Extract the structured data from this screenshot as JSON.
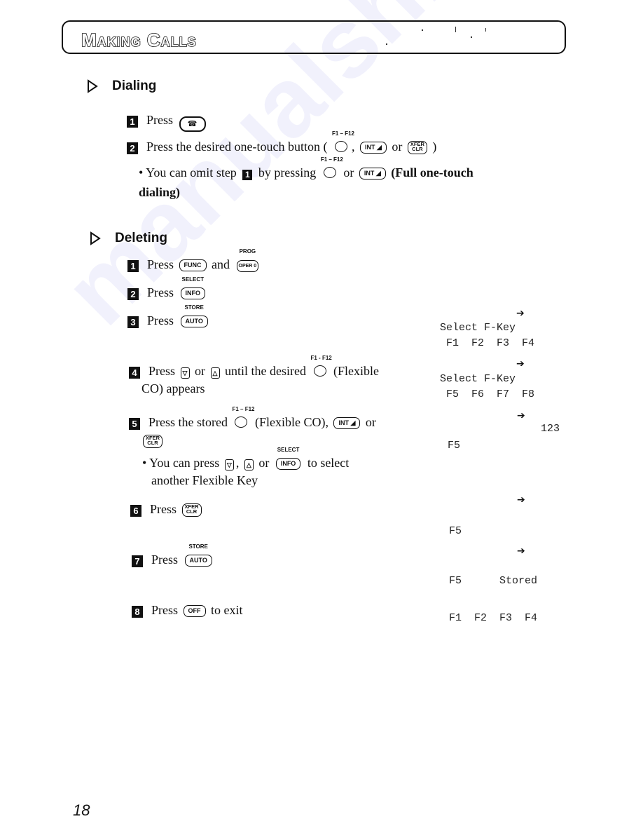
{
  "header": {
    "title": "Making Calls"
  },
  "sections": {
    "dialing": {
      "heading": "Dialing",
      "steps": [
        {
          "num": "1",
          "text": "Press",
          "key": "talk-key"
        },
        {
          "num": "2",
          "text": "Press the desired one-touch button (",
          "key1_label": "F1 – F12",
          "sep1": ",",
          "key2": "INT",
          "or": "or",
          "key3_top": "XFER",
          "key3_bottom": "CLR",
          "close": ")"
        }
      ],
      "note": {
        "pre": "• You can omit step",
        "step_ref": "1",
        "mid": "by pressing",
        "key_label": "F1 – F12",
        "or": "or",
        "key2": "INT",
        "bold_suffix": "(Full one-touch",
        "line2": "dialing)"
      }
    },
    "deleting": {
      "heading": "Deleting",
      "steps": [
        {
          "num": "1",
          "text": "Press",
          "key1": "FUNC",
          "and": "and",
          "key2_above": "PROG",
          "key2": "OPER 0"
        },
        {
          "num": "2",
          "text": "Press",
          "key_above": "SELECT",
          "key": "INFO"
        },
        {
          "num": "3",
          "text": "Press",
          "key_above": "STORE",
          "key": "AUTO"
        },
        {
          "num": "4",
          "pre": "Press",
          "down": "▽",
          "or": "or",
          "up": "△",
          "mid": "until the desired",
          "key_label": "F1 - F12",
          "post": "(Flexible",
          "line2": "CO) appears"
        },
        {
          "num": "5",
          "pre": "Press the stored",
          "key_label": "F1 – F12",
          "mid": "(Flexible CO),",
          "key2": "INT",
          "or": "or",
          "key3_top": "XFER",
          "key3_bottom": "CLR",
          "note_pre": "• You can press",
          "note_sep": ",",
          "note_or": "or",
          "note_key_above": "SELECT",
          "note_key": "INFO",
          "note_post": "to select",
          "note_line2": "another Flexible Key"
        },
        {
          "num": "6",
          "text": "Press",
          "key_top": "XFER",
          "key_bottom": "CLR"
        },
        {
          "num": "7",
          "text": "Press",
          "key_above": "STORE",
          "key": "AUTO"
        },
        {
          "num": "8",
          "text": "Press",
          "key": "OFF",
          "post": "to exit"
        }
      ]
    }
  },
  "display": {
    "arrow_icon": "➔",
    "screens": [
      {
        "line1": "Select F-Key",
        "line2": " F1  F2  F3  F4"
      },
      {
        "line1": "Select F-Key",
        "line2": " F5  F6  F7  F8"
      },
      {
        "line1": "             123",
        "line2": " F5"
      },
      {
        "line1": "",
        "line2": " F5"
      },
      {
        "line1": "",
        "line2": " F5      Stored"
      },
      {
        "line1": "",
        "line2": " F1  F2  F3  F4"
      }
    ]
  },
  "footer": {
    "page_number": "18"
  }
}
